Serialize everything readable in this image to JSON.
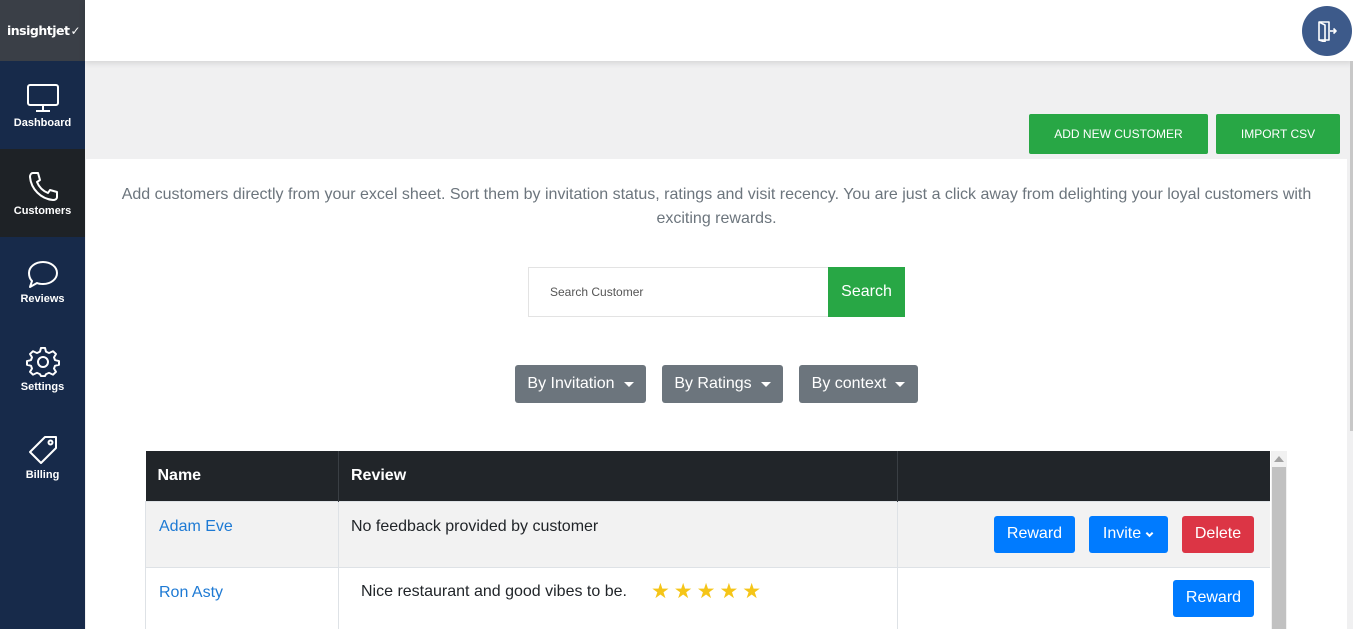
{
  "brand": {
    "logo_text": "insightjet"
  },
  "sidebar": {
    "items": [
      {
        "label": "Dashboard",
        "icon": "monitor-icon"
      },
      {
        "label": "Customers",
        "icon": "phone-icon",
        "active": true
      },
      {
        "label": "Reviews",
        "icon": "chat-bubble-icon"
      },
      {
        "label": "Settings",
        "icon": "gear-icon"
      },
      {
        "label": "Billing",
        "icon": "tag-icon"
      }
    ]
  },
  "header": {
    "logout_icon": "logout-icon"
  },
  "toolbar": {
    "add_label": "ADD NEW CUSTOMER",
    "import_label": "IMPORT CSV"
  },
  "intro": "Add customers directly from your excel sheet. Sort them by invitation status, ratings and visit recency. You are just a click away from delighting your loyal customers with exciting rewards.",
  "search": {
    "placeholder": "Search Customer",
    "button_label": "Search"
  },
  "filters": [
    "By Invitation",
    "By Ratings",
    "By context"
  ],
  "table": {
    "headers": [
      "Name",
      "Review",
      ""
    ],
    "rows": [
      {
        "name": "Adam Eve",
        "review": "No feedback provided by customer",
        "stars": 0,
        "actions": [
          "Reward",
          "Invite",
          "Delete"
        ]
      },
      {
        "name": "Ron Asty",
        "review": "Nice restaurant and good vibes to be.",
        "stars": 5,
        "actions": [
          "Reward"
        ]
      }
    ]
  },
  "colors": {
    "sidebar": "#172a4a",
    "green": "#28a745",
    "blue": "#007bff",
    "red": "#dc3545",
    "gray_button": "#6c757d",
    "star": "#f5c518"
  }
}
